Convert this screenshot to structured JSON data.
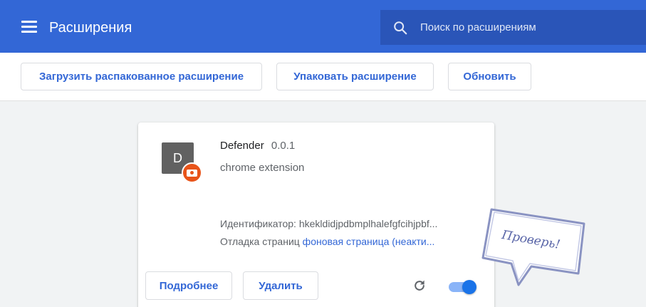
{
  "header": {
    "title": "Расширения",
    "search_placeholder": "Поиск по расширениям",
    "colors": {
      "topbar": "#3367d6",
      "search": "#2a55b8"
    }
  },
  "toolbar": {
    "load_unpacked": "Загрузить распакованное расширение",
    "pack": "Упаковать расширение",
    "update": "Обновить"
  },
  "extension": {
    "icon_letter": "D",
    "name": "Defender",
    "version": "0.0.1",
    "description": "chrome extension",
    "id_label": "Идентификатор:",
    "id_value": "hkekldidjpdbmplhalefgfcihjpbf...",
    "inspect_label": "Отладка страниц",
    "inspect_link": "фоновая страница (неакти...",
    "details_button": "Подробнее",
    "remove_button": "Удалить",
    "enabled": true,
    "icons": [
      "reload-icon",
      "toggle-switch",
      "camera-badge-icon"
    ]
  },
  "sticker": {
    "text": "Проверь!"
  }
}
